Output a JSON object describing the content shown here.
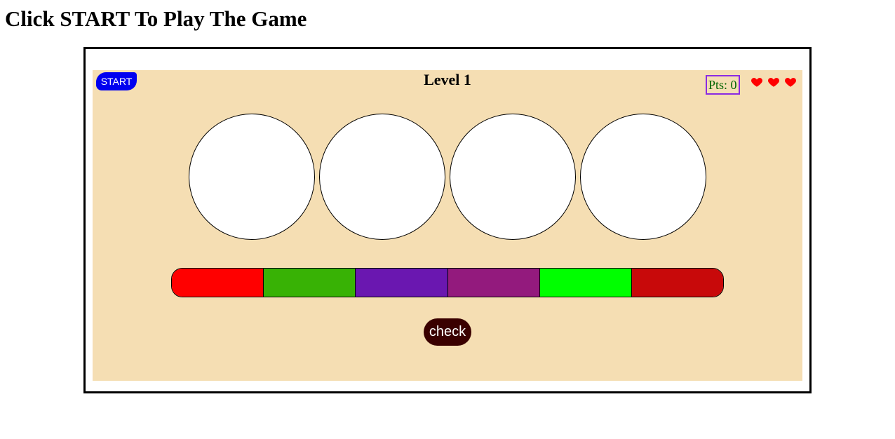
{
  "page": {
    "heading": "Click START To Play The Game"
  },
  "game": {
    "start_label": "START",
    "level_title": "Level 1",
    "points_text": "Pts: 0",
    "lives": 3,
    "slots": [
      {
        "color": "#ffffff"
      },
      {
        "color": "#ffffff"
      },
      {
        "color": "#ffffff"
      },
      {
        "color": "#ffffff"
      }
    ],
    "palette": [
      {
        "name": "red",
        "color": "#ff0000"
      },
      {
        "name": "green",
        "color": "#38b205"
      },
      {
        "name": "purple",
        "color": "#6a17b0"
      },
      {
        "name": "magenta",
        "color": "#931a7d"
      },
      {
        "name": "lime",
        "color": "#00ff00"
      },
      {
        "name": "dark-red",
        "color": "#c8090a"
      }
    ],
    "check_label": "check"
  },
  "colors": {
    "board_background": "#f5deb3",
    "start_button": "#0000f0",
    "check_button": "#3a0000",
    "points_border": "#8a2be2",
    "points_text": "#006400",
    "heart": "#ff0000"
  }
}
